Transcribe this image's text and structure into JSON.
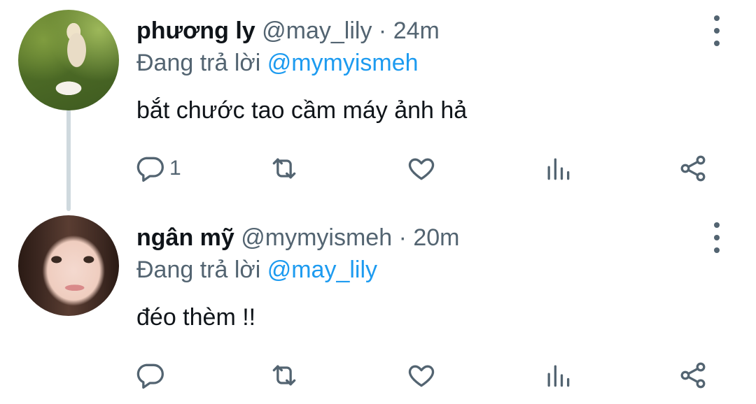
{
  "tweets": [
    {
      "display_name": "phương ly",
      "handle": "@may_lily",
      "separator": "·",
      "time": "24m",
      "reply_prefix": "Đang trả lời",
      "reply_to": "@mymyismeh",
      "text": "bắt chước tao cầm máy ảnh hả",
      "reply_count": "1",
      "avatar_icon": "user-avatar-photo"
    },
    {
      "display_name": "ngân mỹ",
      "handle": "@mymyismeh",
      "separator": "·",
      "time": "20m",
      "reply_prefix": "Đang trả lời",
      "reply_to": "@may_lily",
      "text": "đéo thèm !!",
      "reply_count": "",
      "avatar_icon": "user-avatar-photo"
    }
  ],
  "icons": {
    "reply": "reply-icon",
    "retweet": "retweet-icon",
    "like": "heart-icon",
    "views": "views-bar-chart-icon",
    "share": "share-icon",
    "more": "more-vertical-icon"
  },
  "colors": {
    "text_primary": "#0f1419",
    "text_secondary": "#536471",
    "mention": "#1d9bf0",
    "thread_line": "#cfd9de"
  }
}
